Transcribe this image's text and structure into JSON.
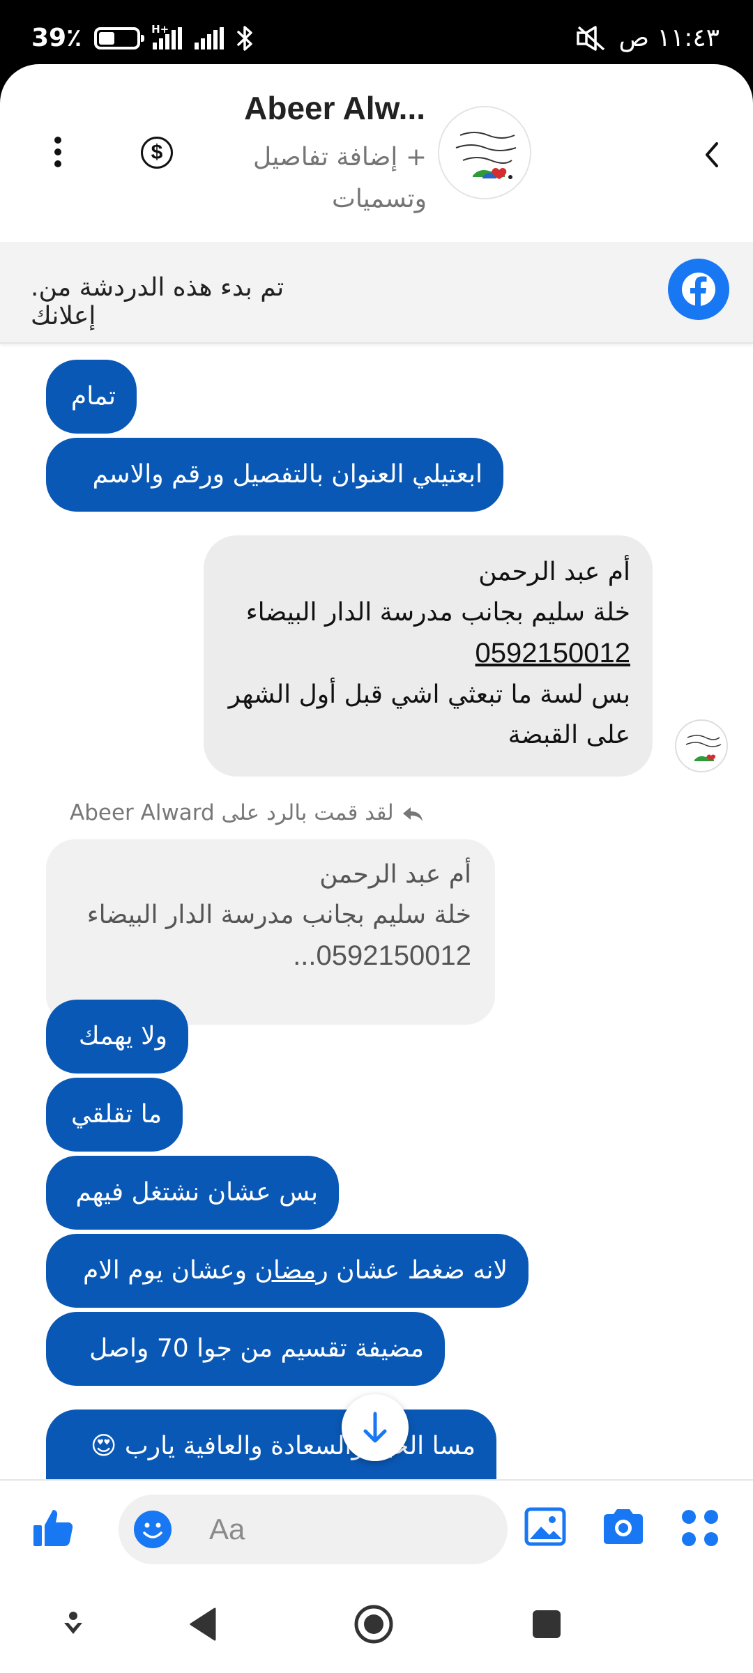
{
  "status_bar": {
    "battery": "39٪",
    "network": "H+",
    "time": "١١:٤٣ ص"
  },
  "header": {
    "contact_name": "Abeer Alw...",
    "subtitle": "+ إضافة تفاصيل وتسميات"
  },
  "ad_banner": {
    "text": ".تم بدء هذه الدردشة من إعلانك"
  },
  "messages": {
    "m1": "تمام",
    "m2": "ابعتيلي العنوان بالتفصيل ورقم والاسم",
    "incoming": {
      "line1": "أم عبد الرحمن",
      "line2": "خلة سليم بجانب مدرسة الدار البيضاء",
      "phone": "0592150012",
      "line4": "بس لسة ما تبعثي اشي قبل أول الشهر",
      "line5": "على القبضة"
    },
    "reply_note": "لقد قمت بالرد على Abeer Alward",
    "quoted": {
      "line1": "أم عبد الرحمن",
      "line2": "خلة سليم بجانب مدرسة الدار البيضاء",
      "line3": "0592150012..."
    },
    "m3": "ولا يهمك",
    "m4": "ما تقلقي",
    "m5": "بس عشان نشتغل فيهم",
    "m6_before": "لانه ضغط عشان ",
    "m6_underlined": "رمضان",
    "m6_after": " وعشان يوم الام",
    "m7": "مضيفة تقسيم من جوا 70 واصل",
    "m8": "مسا الخير والسعادة والعافية يارب 😍"
  },
  "composer": {
    "placeholder": "Aa"
  },
  "icons": [
    "battery-icon",
    "signal-icon",
    "bluetooth-icon",
    "mute-icon",
    "back-icon",
    "dollar-icon",
    "more-icon",
    "facebook-icon",
    "reply-arrow-icon",
    "arrow-down-icon",
    "like-icon",
    "emoji-icon",
    "gallery-icon",
    "camera-icon",
    "apps-icon",
    "nav-back-icon",
    "nav-home-icon",
    "nav-recents-icon",
    "assistant-icon"
  ],
  "colors": {
    "outgoing_bubble": "#0a58b5",
    "incoming_bubble": "#ececec",
    "accent": "#1877f2"
  }
}
